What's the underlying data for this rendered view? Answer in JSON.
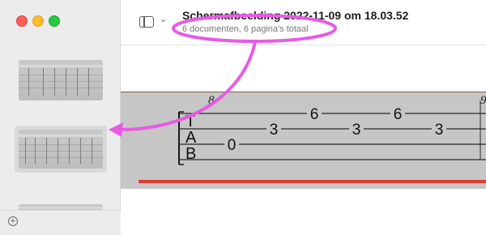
{
  "window": {
    "title": "Schermafbeelding 2022-11-09 om 18.03.52",
    "subtitle": "6 documenten, 6 pagina's totaal"
  },
  "toolbar": {
    "sidebar_toggle_icon": "sidebar-icon",
    "chevron_icon": "chevron-down-icon",
    "chevron_glyph": "⌄"
  },
  "sidebar": {
    "thumbnail_count": 3,
    "selected_index": 1,
    "add_icon": "plus-circle-icon",
    "add_glyph": "+"
  },
  "tablature": {
    "measure_numbers": [
      "8",
      "9"
    ],
    "clef_letters": [
      "T",
      "A",
      "B"
    ],
    "notes": [
      {
        "string": 3,
        "fret": "0"
      },
      {
        "string": 2,
        "fret": "3"
      },
      {
        "string": 1,
        "fret": "6"
      },
      {
        "string": 2,
        "fret": "3"
      },
      {
        "string": 1,
        "fret": "6"
      },
      {
        "string": 2,
        "fret": "3"
      }
    ]
  },
  "colors": {
    "annotation": "#e85ae4",
    "red_line": "#e03a33",
    "page_background": "#c6c6c6"
  }
}
